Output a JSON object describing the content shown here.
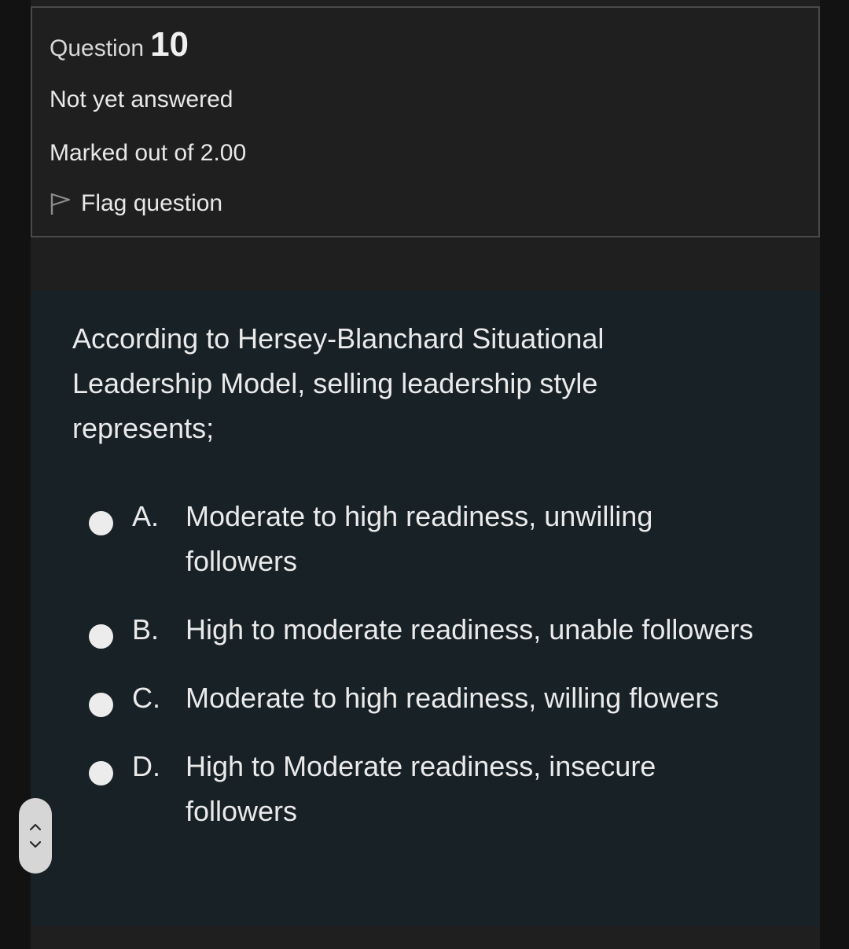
{
  "question": {
    "prefix": "Question",
    "number": "10",
    "state": "Not yet answered",
    "grade": "Marked out of 2.00",
    "flag_label": "Flag question",
    "text": "According to Hersey-Blanchard Situational Leadership Model, selling leadership style represents;"
  },
  "answers": [
    {
      "letter": "A.",
      "text": "Moderate to high readiness, unwilling followers"
    },
    {
      "letter": "B.",
      "text": "High to moderate readiness, unable followers"
    },
    {
      "letter": "C.",
      "text": "Moderate to high readiness, willing flowers"
    },
    {
      "letter": "D.",
      "text": "High to Moderate readiness, insecure followers"
    }
  ],
  "icons": {
    "flag": "flag-outline-icon",
    "scroll_up": "chevron-up-icon",
    "scroll_down": "chevron-down-icon"
  },
  "colors": {
    "page_background": "#121212",
    "info_background": "#1f1f1f",
    "content_background": "#182126",
    "text": "#eaeaea"
  }
}
